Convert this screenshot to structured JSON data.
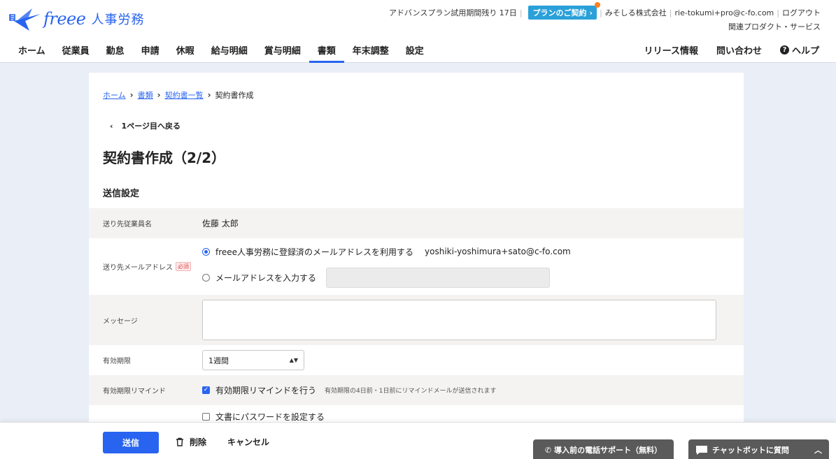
{
  "header": {
    "brand": "freee",
    "product": "人事労務",
    "trial_text": "アドバンスプラン試用期間残り 17日",
    "plan_button": "プランのご契約",
    "company": "みそしる株式会社",
    "email": "rie-tokumi+pro@c-fo.com",
    "logout": "ログアウト",
    "related": "関連プロダクト・サービス"
  },
  "nav": {
    "items": [
      {
        "label": "ホーム",
        "active": false
      },
      {
        "label": "従業員",
        "active": false
      },
      {
        "label": "勤怠",
        "active": false
      },
      {
        "label": "申請",
        "active": false
      },
      {
        "label": "休暇",
        "active": false
      },
      {
        "label": "給与明細",
        "active": false
      },
      {
        "label": "賞与明細",
        "active": false
      },
      {
        "label": "書類",
        "active": true
      },
      {
        "label": "年末調整",
        "active": false
      },
      {
        "label": "設定",
        "active": false
      }
    ],
    "release": "リリース情報",
    "contact": "問い合わせ",
    "help": "ヘルプ"
  },
  "breadcrumb": {
    "items": [
      "ホーム",
      "書類",
      "契約書一覧"
    ],
    "current": "契約書作成"
  },
  "back_link": "1ページ目へ戻る",
  "page_title": "契約書作成（2/2）",
  "section_title": "送信設定",
  "form": {
    "recipient_label": "送り先従業員名",
    "recipient_value": "佐藤 太郎",
    "email_label": "送り先メールアドレス",
    "required_badge": "必須",
    "email_option_registered": "freee人事労務に登録済のメールアドレスを利用する",
    "registered_email": "yoshiki-yoshimura+sato@c-fo.com",
    "email_option_input": "メールアドレスを入力する",
    "message_label": "メッセージ",
    "expiry_label": "有効期限",
    "expiry_value": "1週間",
    "reminder_label": "有効期限リマインド",
    "reminder_checkbox": "有効期限リマインドを行う",
    "reminder_hint": "有効期限の4日前・1日前にリマインドメールが送信されます",
    "password_checkbox": "文書にパスワードを設定する"
  },
  "footer": {
    "send": "送信",
    "delete": "削除",
    "cancel": "キャンセル",
    "phone_support": "導入前の電話サポート（無料）",
    "chatbot": "チャットボットに質問"
  },
  "colors": {
    "accent": "#2864f0",
    "plan_button": "#2aa0d9",
    "notification_dot": "#ff7f1e",
    "background": "#e9eef7"
  }
}
